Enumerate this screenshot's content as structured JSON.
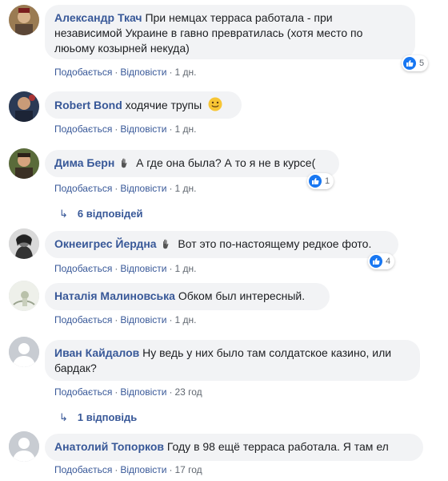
{
  "actions": {
    "like": "Подобається",
    "reply": "Відповісти",
    "separator": "·"
  },
  "comments": [
    {
      "author": "Александр Ткач",
      "text_line1": "При немцах терраса работала - при",
      "text_line2": "независимой Украине в гавно превратилась (хотя место по",
      "text_line3": "люьому козырней некуда)",
      "time": "1 дн.",
      "reactions": "5"
    },
    {
      "author": "Robert Bond",
      "text": "ходячие трупы",
      "time": "1 дн."
    },
    {
      "author": "Дима Берн",
      "text": "А где она была? А то я не в курсе(",
      "time": "1 дн.",
      "reactions": "1",
      "replies": "6 відповідей"
    },
    {
      "author": "Окнеигрес Йердна",
      "text": "Вот это по-настоящему редкое фото.",
      "time": "1 дн.",
      "reactions": "4"
    },
    {
      "author": "Наталія Малиновська",
      "text": "Обком был интересный.",
      "time": "1 дн."
    },
    {
      "author": "Иван Кайдалов",
      "text_line1": "Ну ведь у них было там солдатское казино, или",
      "text_line2": "бардак?",
      "time": "23 год",
      "replies": "1 відповідь"
    },
    {
      "author": "Анатолий Топорков",
      "text": "Году в 98 ещё терраса работала. Я там ел",
      "time": "17 год"
    }
  ],
  "colors": {
    "author": "#385898",
    "bubble": "#f2f3f5",
    "meta": "#606770",
    "like": "#1877f2"
  }
}
